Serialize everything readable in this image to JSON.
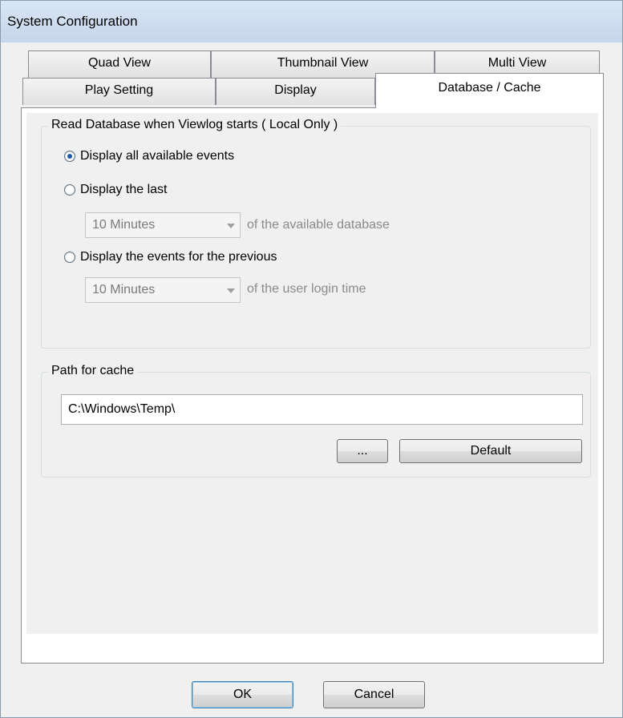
{
  "window": {
    "title": "System Configuration"
  },
  "tabs": {
    "row1": [
      {
        "label": "Quad View"
      },
      {
        "label": "Thumbnail View"
      },
      {
        "label": "Multi View"
      }
    ],
    "row2": [
      {
        "label": "Play Setting"
      },
      {
        "label": "Display"
      },
      {
        "label": "Database / Cache",
        "active": true
      }
    ]
  },
  "read_db": {
    "legend": "Read Database when Viewlog starts ( Local Only )",
    "options": [
      {
        "label": "Display all available events",
        "checked": true
      },
      {
        "label": "Display the last",
        "checked": false
      },
      {
        "label": "Display the events for the previous",
        "checked": false
      }
    ],
    "last_combo": {
      "value": "10 Minutes",
      "suffix": "of the available database"
    },
    "previous_combo": {
      "value": "10 Minutes",
      "suffix": "of the user login time"
    }
  },
  "cache": {
    "legend": "Path for cache",
    "path_value": "C:\\Windows\\Temp\\",
    "browse_label": "...",
    "default_label": "Default"
  },
  "buttons": {
    "ok": "OK",
    "cancel": "Cancel"
  }
}
